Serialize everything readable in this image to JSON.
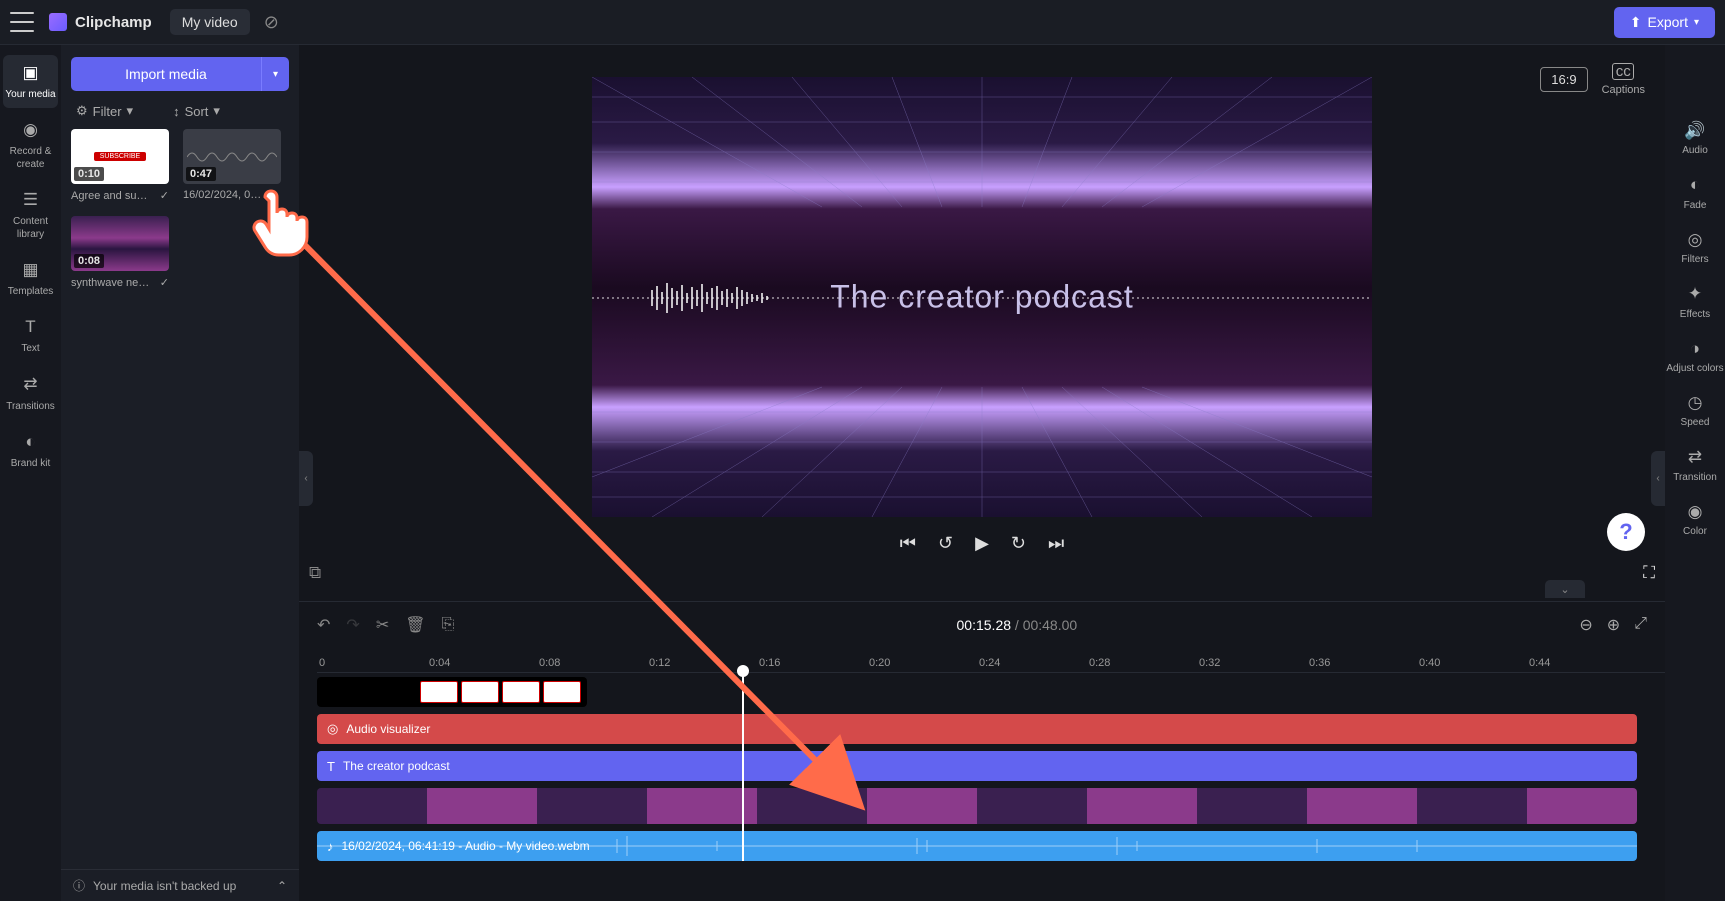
{
  "header": {
    "app_name": "Clipchamp",
    "video_title": "My video",
    "export_label": "Export",
    "aspect_ratio": "16:9",
    "captions_label": "Captions"
  },
  "left_nav": {
    "your_media": "Your media",
    "record_create": "Record & create",
    "content_library": "Content library",
    "templates": "Templates",
    "text": "Text",
    "transitions": "Transitions",
    "brand_kit": "Brand kit"
  },
  "media_panel": {
    "import_label": "Import media",
    "filter_label": "Filter",
    "sort_label": "Sort",
    "thumbs": [
      {
        "duration": "0:10",
        "name": "Agree and su…"
      },
      {
        "duration": "0:47",
        "name": "16/02/2024, 0…"
      },
      {
        "duration": "0:08",
        "name": "synthwave ne…"
      }
    ]
  },
  "preview": {
    "overlay_text": "The creator podcast"
  },
  "timeline": {
    "current_time": "00:15.28",
    "duration": "00:48.00",
    "ruler": [
      "0",
      "0:04",
      "0:08",
      "0:12",
      "0:16",
      "0:20",
      "0:24",
      "0:28",
      "0:32",
      "0:36",
      "0:40",
      "0:44"
    ],
    "tracks": {
      "audio_viz": "Audio visualizer",
      "text": "The creator podcast",
      "audio_file": "16/02/2024, 06:41:19 - Audio - My video.webm"
    }
  },
  "right_panel": {
    "audio": "Audio",
    "fade": "Fade",
    "filters": "Filters",
    "effects": "Effects",
    "adjust_colors": "Adjust colors",
    "speed": "Speed",
    "transition": "Transition",
    "color": "Color"
  },
  "footer": {
    "backup_msg": "Your media isn't backed up"
  }
}
